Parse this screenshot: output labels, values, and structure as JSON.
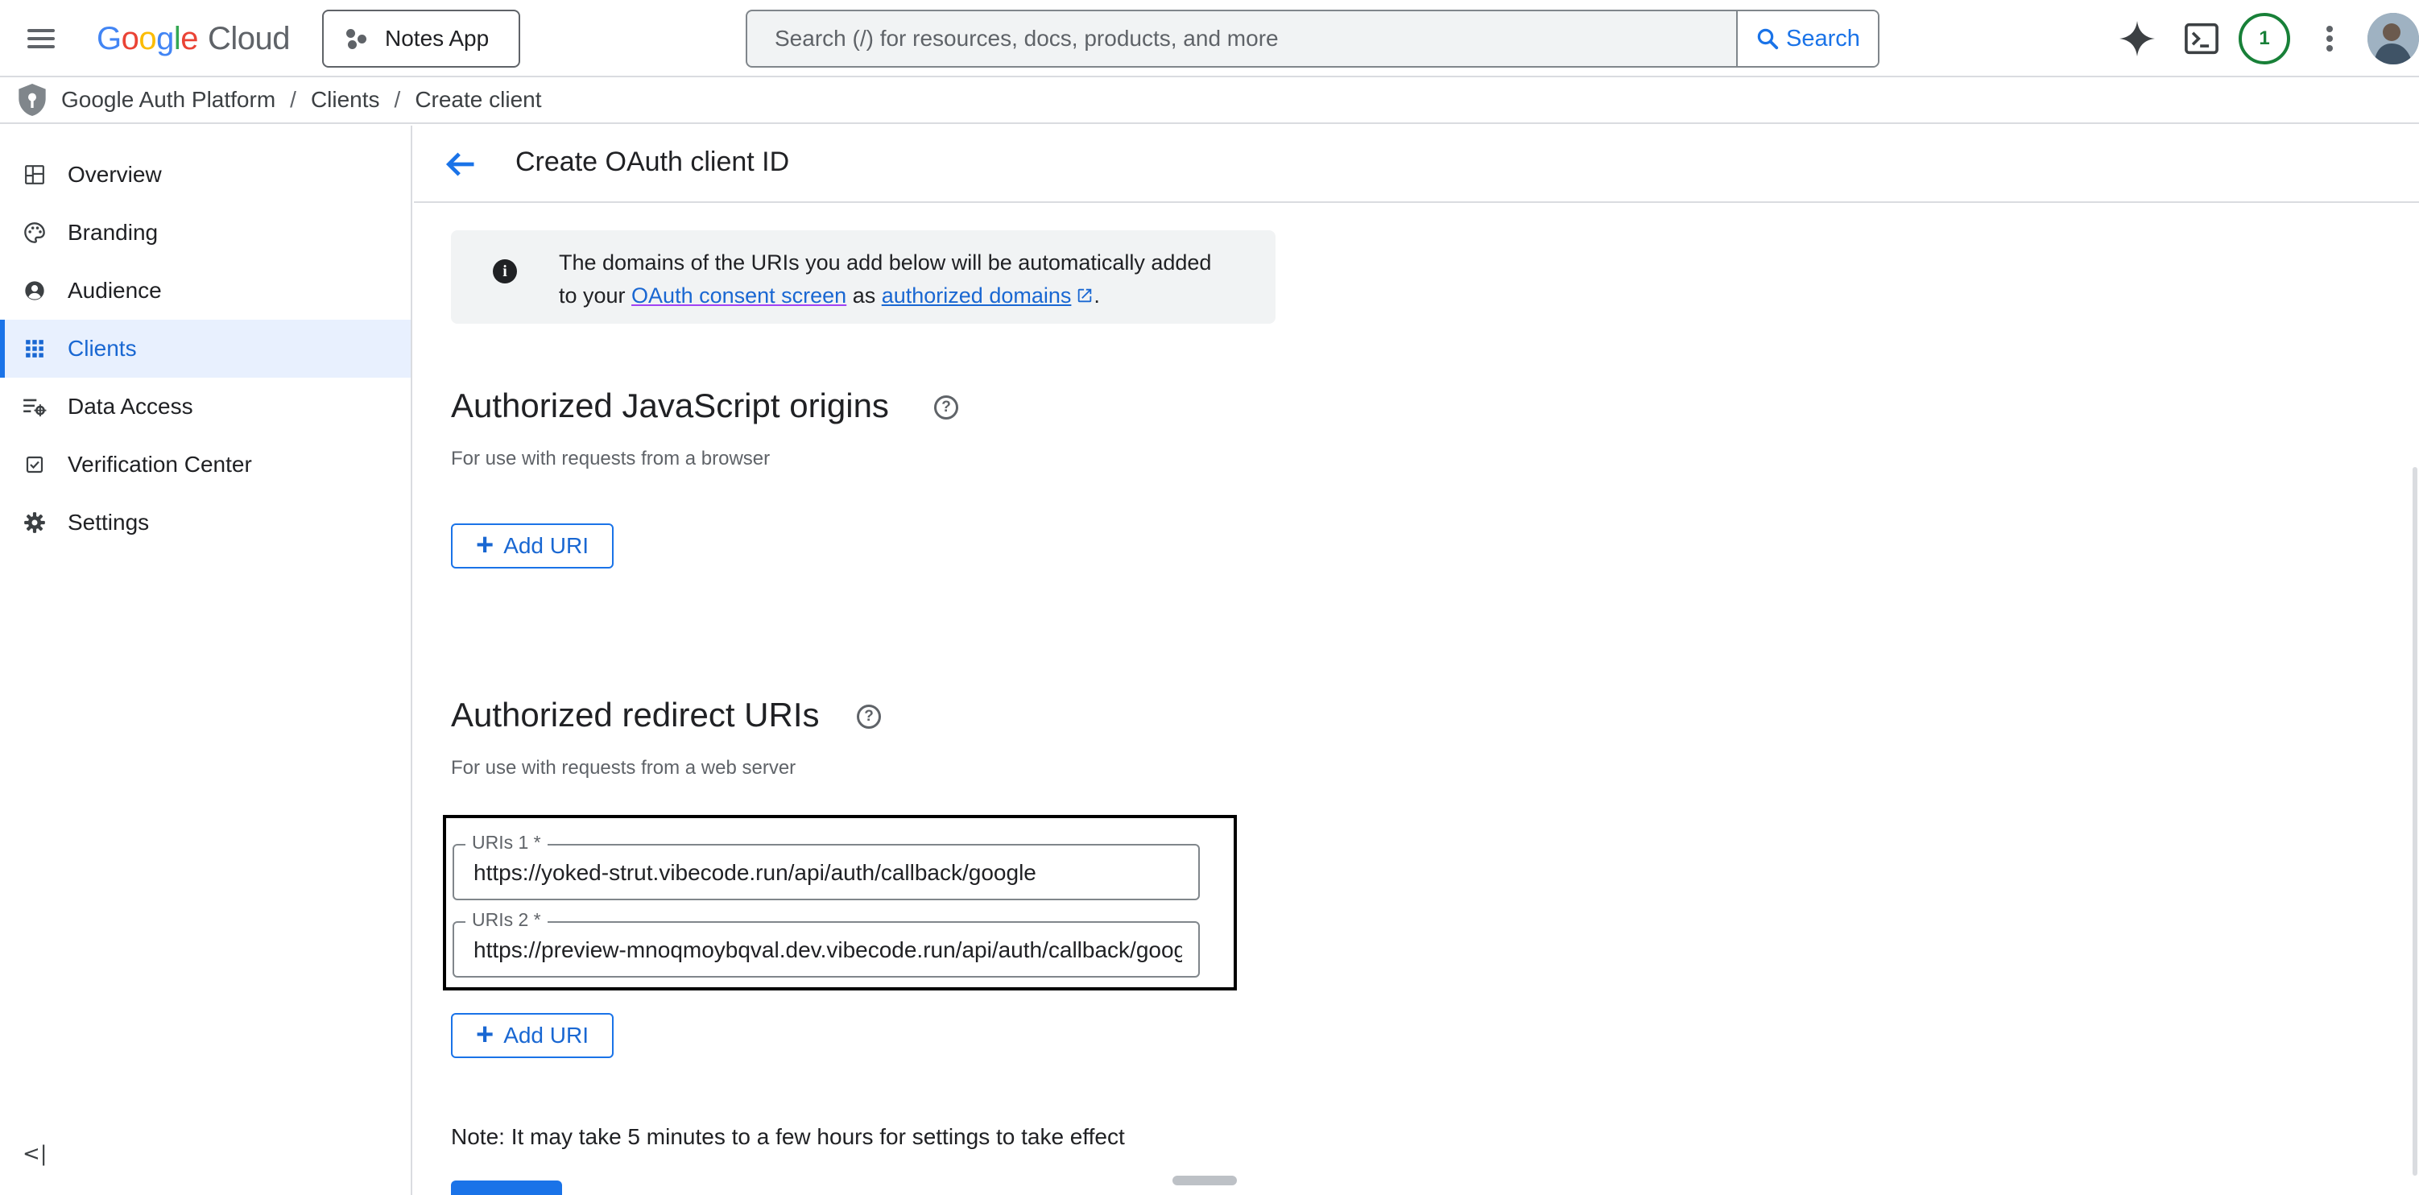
{
  "topbar": {
    "logo_google": "Google",
    "logo_cloud": "Cloud",
    "project_name": "Notes App",
    "search_placeholder": "Search (/) for resources, docs, products, and more",
    "search_button": "Search",
    "notification_count": "1"
  },
  "breadcrumb": [
    "Google Auth Platform",
    "Clients",
    "Create client"
  ],
  "sidebar": {
    "items": [
      {
        "label": "Overview",
        "icon": "dashboard-icon",
        "active": false
      },
      {
        "label": "Branding",
        "icon": "palette-icon",
        "active": false
      },
      {
        "label": "Audience",
        "icon": "account-circle-icon",
        "active": false
      },
      {
        "label": "Clients",
        "icon": "apps-grid-icon",
        "active": true
      },
      {
        "label": "Data Access",
        "icon": "data-access-icon",
        "active": false
      },
      {
        "label": "Verification Center",
        "icon": "verified-checkbox-icon",
        "active": false
      },
      {
        "label": "Settings",
        "icon": "gear-icon",
        "active": false
      }
    ],
    "collapse_label": "<|"
  },
  "page": {
    "title": "Create OAuth client ID"
  },
  "info": {
    "text_1": "The domains of the URIs you add below will be automatically added",
    "text_2": "to your ",
    "link_consent": "OAuth consent screen",
    "text_3": " as ",
    "link_domains": "authorized domains",
    "text_4": "."
  },
  "js_origins": {
    "title": "Authorized JavaScript origins",
    "subtitle": "For use with requests from a browser",
    "add_label": "Add URI"
  },
  "redirect_uris": {
    "title": "Authorized redirect URIs",
    "subtitle": "For use with requests from a web server",
    "fields": [
      {
        "label": "URIs 1 *",
        "value": "https://yoked-strut.vibecode.run/api/auth/callback/google"
      },
      {
        "label": "URIs 2 *",
        "value": "https://preview-mnoqmoybqval.dev.vibecode.run/api/auth/callback/google"
      }
    ],
    "add_label": "Add URI"
  },
  "note": "Note: It may take 5 minutes to a few hours for settings to take effect",
  "colors": {
    "accent": "#1a73e8",
    "active_bg": "#e8f0fe",
    "badge": "#188038"
  }
}
